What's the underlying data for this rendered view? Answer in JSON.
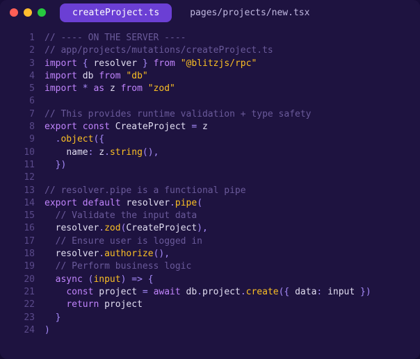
{
  "tabs": [
    {
      "label": "createProject.ts",
      "active": true
    },
    {
      "label": "pages/projects/new.tsx",
      "active": false
    }
  ],
  "lineCount": 24,
  "code": {
    "l1": {
      "comment": "// ---- ON THE SERVER ----"
    },
    "l2": {
      "comment": "// app/projects/mutations/createProject.ts"
    },
    "l3": {
      "kw1": "import",
      "p1": "{ ",
      "id": "resolver",
      "p2": " }",
      "kw2": "from",
      "str": "\"@blitzjs/rpc\""
    },
    "l4": {
      "kw1": "import",
      "id": "db",
      "kw2": "from",
      "str": "\"db\""
    },
    "l5": {
      "kw1": "import",
      "p1": "*",
      "kw2": "as",
      "id": "z",
      "kw3": "from",
      "str": "\"zod\""
    },
    "l7": {
      "comment": "// This provides runtime validation + type safety"
    },
    "l8": {
      "kw1": "export",
      "kw2": "const",
      "id": "CreateProject",
      "op": "=",
      "id2": "z"
    },
    "l9": {
      "p1": ".",
      "fn": "object",
      "p2": "({"
    },
    "l10": {
      "id": "name",
      "p1": ": ",
      "id2": "z",
      "p2": ".",
      "fn": "string",
      "p3": "()",
      "p4": ","
    },
    "l11": {
      "p1": "})"
    },
    "l13": {
      "comment": "// resolver.pipe is a functional pipe"
    },
    "l14": {
      "kw1": "export",
      "kw2": "default",
      "id": "resolver",
      "p1": ".",
      "fn": "pipe",
      "p2": "("
    },
    "l15": {
      "comment": "// Validate the input data"
    },
    "l16": {
      "id": "resolver",
      "p1": ".",
      "fn": "zod",
      "p2": "(",
      "id2": "CreateProject",
      "p3": ")",
      "p4": ","
    },
    "l17": {
      "comment": "// Ensure user is logged in"
    },
    "l18": {
      "id": "resolver",
      "p1": ".",
      "fn": "authorize",
      "p2": "()",
      "p3": ","
    },
    "l19": {
      "comment": "// Perform business logic"
    },
    "l20": {
      "kw1": "async",
      "p1": "(",
      "param": "input",
      "p2": ")",
      "op": "=>",
      "p3": "{"
    },
    "l21": {
      "kw1": "const",
      "id": "project",
      "op1": "=",
      "kw2": "await",
      "id2": "db",
      "p1": ".",
      "id3": "project",
      "p2": ".",
      "fn": "create",
      "p3": "({ ",
      "id4": "data",
      "p4": ": ",
      "id5": "input",
      "p5": " })"
    },
    "l22": {
      "kw1": "return",
      "id": "project"
    },
    "l23": {
      "p1": "}"
    },
    "l24": {
      "p1": ")"
    }
  }
}
